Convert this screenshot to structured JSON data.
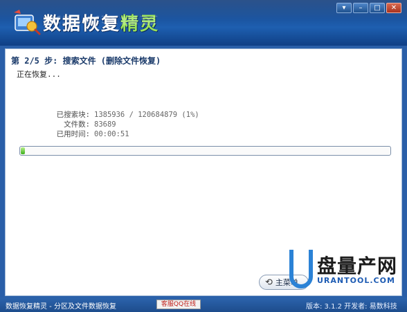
{
  "app": {
    "title_main": "数据恢复",
    "title_accent": "精灵"
  },
  "window_buttons": [
    "▾",
    "–",
    "□",
    "✕"
  ],
  "step": {
    "title": "第 2/5 步: 搜索文件 (删除文件恢复)",
    "status": "正在恢复..."
  },
  "stats": [
    {
      "label": "已搜索块:",
      "value": "1385936 / 120684879 (1%)"
    },
    {
      "label": "文件数:",
      "value": "83689"
    },
    {
      "label": "已用时间:",
      "value": "00:00:51"
    }
  ],
  "progress": {
    "fraction": 0.01
  },
  "main_button": {
    "label": "主菜单"
  },
  "statusbar": {
    "left": "数据恢复精灵 - 分区及文件数据恢复",
    "qq": "客服QQ在线",
    "right": "版本: 3.1.2  开发者: 易数科技"
  },
  "watermark": {
    "text": "盘量产网",
    "url": "URANTOOL.COM"
  },
  "colors": {
    "banner": "#1b56a3",
    "accent": "#9be35a",
    "progress": "#3cae1c"
  }
}
